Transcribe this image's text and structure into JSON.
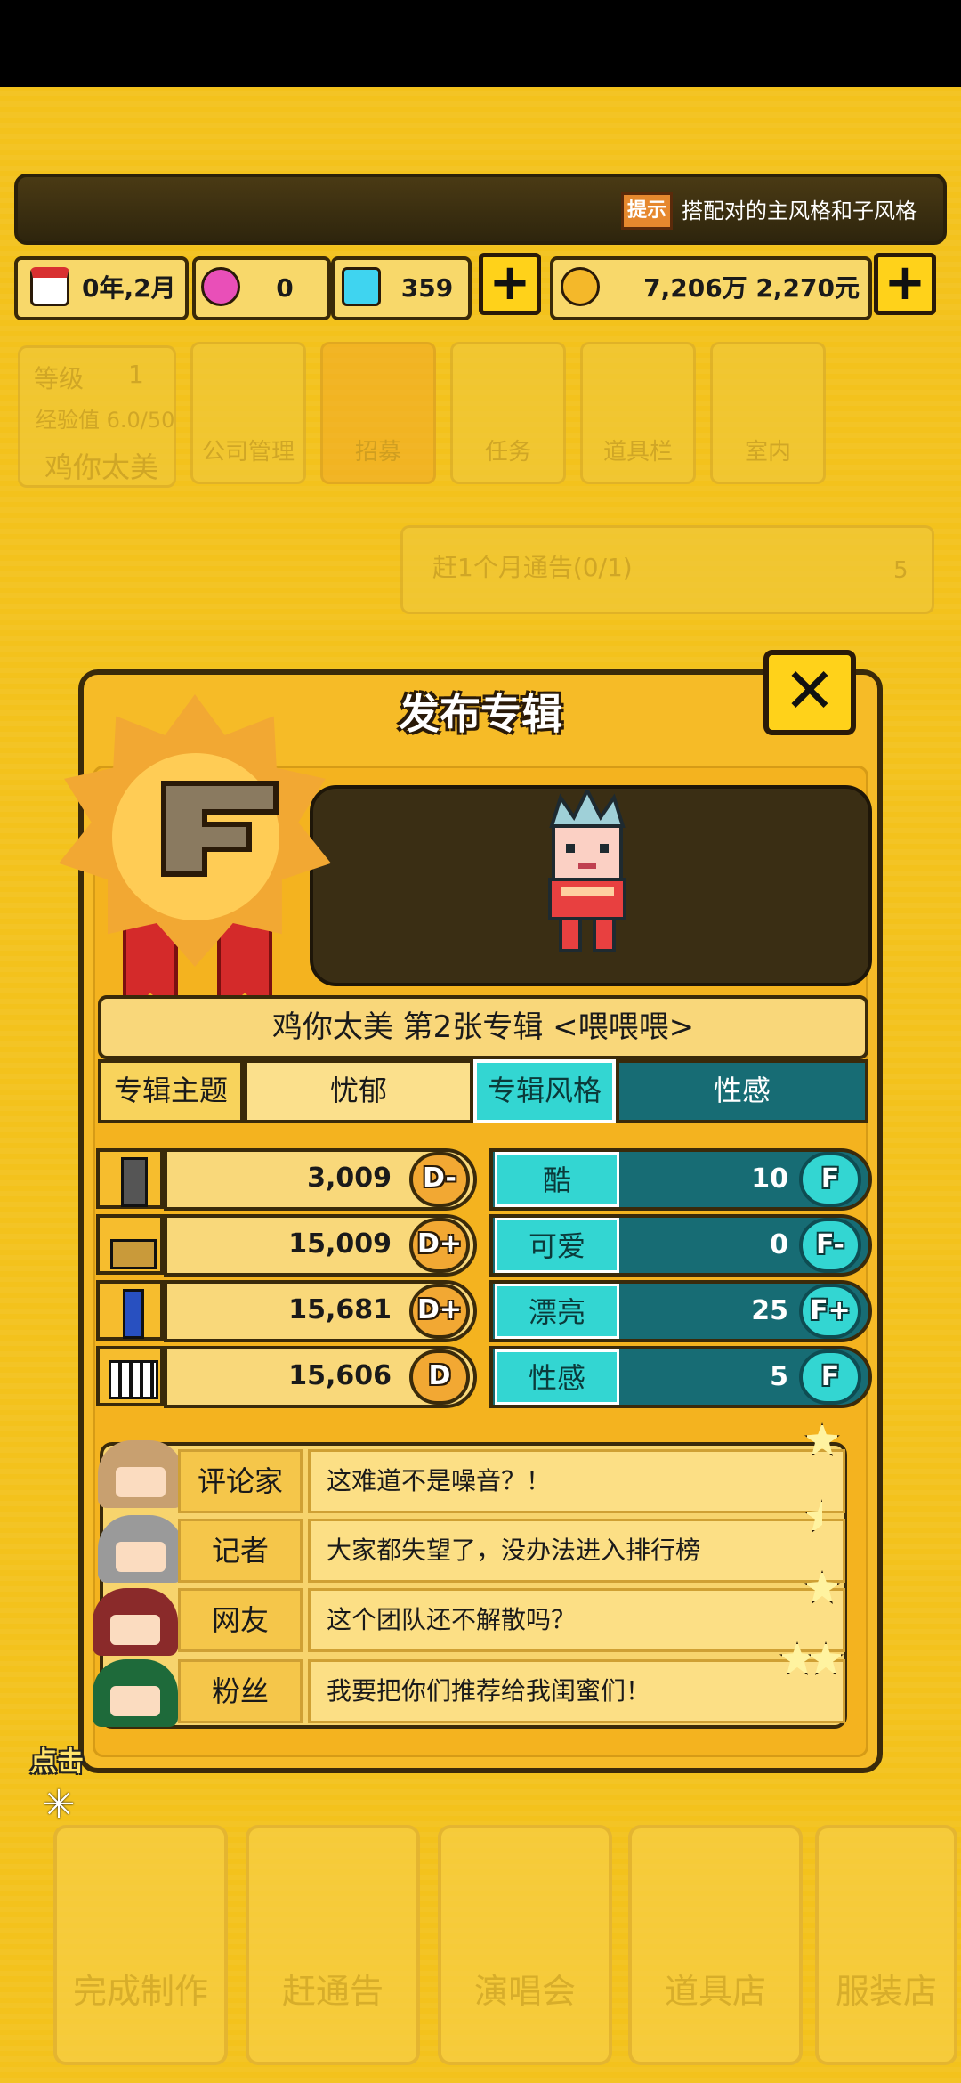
{
  "hint": {
    "icon_label": "提示",
    "text": "搭配对的主风格和子风格"
  },
  "resources": {
    "date": "0年,2月",
    "pink_gem": "0",
    "blue_gem": "359",
    "money": "7,206万 2,270元"
  },
  "background": {
    "level_label": "等级",
    "level_value": "1",
    "exp_label": "经验值 6.0/50",
    "player_name": "鸡你太美",
    "menu": [
      "公司管理",
      "招募",
      "任务",
      "道具栏",
      "室内"
    ],
    "quest_text": "赶1个月通告(0/1)",
    "quest_reward": "5",
    "bottom_nav": [
      "完成制作",
      "赶通告",
      "演唱会",
      "道具店",
      "服装店"
    ]
  },
  "dialog": {
    "title": "发布专辑",
    "grade": "F",
    "album_name": "鸡你太美 第2张专辑 <喂喂喂>",
    "theme_label": "专辑主题",
    "theme_value": "忧郁",
    "style_label": "专辑风格",
    "style_value": "性感",
    "stats": [
      {
        "icon": "microphone-icon",
        "value": "3,009",
        "grade": "D-"
      },
      {
        "icon": "dance-shoe-icon",
        "value": "15,009",
        "grade": "D+"
      },
      {
        "icon": "pen-icon",
        "value": "15,681",
        "grade": "D+"
      },
      {
        "icon": "piano-keys-icon",
        "value": "15,606",
        "grade": "D"
      }
    ],
    "styles": [
      {
        "name": "酷",
        "value": "10",
        "grade": "F"
      },
      {
        "name": "可爱",
        "value": "0",
        "grade": "F-"
      },
      {
        "name": "漂亮",
        "value": "25",
        "grade": "F+"
      },
      {
        "name": "性感",
        "value": "5",
        "grade": "F"
      }
    ],
    "reviews": [
      {
        "role": "评论家",
        "comment": "这难道不是噪音？！",
        "stars": "1"
      },
      {
        "role": "记者",
        "comment": "大家都失望了，没办法进入排行榜",
        "stars": "0.5"
      },
      {
        "role": "网友",
        "comment": "这个团队还不解散吗？",
        "stars": "1"
      },
      {
        "role": "粉丝",
        "comment": "我要把你们推荐给我闺蜜们！",
        "stars": "2"
      }
    ]
  },
  "tap_hint": "点击",
  "colors": {
    "background": "#f3c21c",
    "teal": "#176c74",
    "teal_light": "#33d6d2",
    "outline": "#3a2a0a"
  }
}
